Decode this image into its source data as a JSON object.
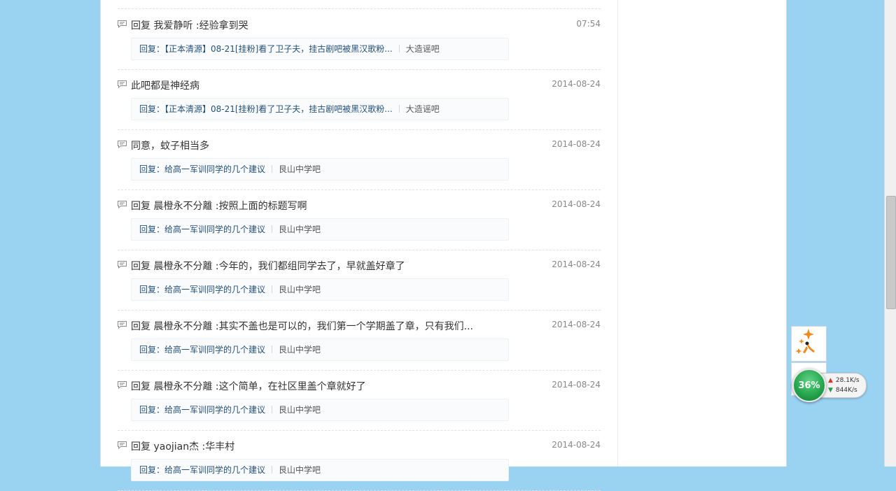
{
  "posts": [
    {
      "title": "回复 我爱静听 :经验拿到哭",
      "time": "07:54",
      "prefix": "回复：",
      "thread": "【正本清源】08-21[挂粉]看了卫子夫，挂古剧吧被黑汉歌粉...",
      "forum": "大造谣吧"
    },
    {
      "title": "此吧都是神经病",
      "time": "2014-08-24",
      "prefix": "回复：",
      "thread": "【正本清源】08-21[挂粉]看了卫子夫，挂古剧吧被黑汉歌粉...",
      "forum": "大造谣吧"
    },
    {
      "title": "同意，蚊子相当多",
      "time": "2014-08-24",
      "prefix": "回复：",
      "thread": "给高一军训同学的几个建议",
      "forum": "艮山中学吧"
    },
    {
      "title": "回复 晨橙永不分離 :按照上面的标题写啊",
      "time": "2014-08-24",
      "prefix": "回复：",
      "thread": "给高一军训同学的几个建议",
      "forum": "艮山中学吧"
    },
    {
      "title": "回复 晨橙永不分離 :今年的，我们都组同学去了，早就盖好章了",
      "time": "2014-08-24",
      "prefix": "回复：",
      "thread": "给高一军训同学的几个建议",
      "forum": "艮山中学吧"
    },
    {
      "title": "回复 晨橙永不分離 :其实不盖也是可以的，我们第一个学期盖了章，只有我们...",
      "time": "2014-08-24",
      "prefix": "回复：",
      "thread": "给高一军训同学的几个建议",
      "forum": "艮山中学吧"
    },
    {
      "title": "回复 晨橙永不分離 :这个简单，在社区里盖个章就好了",
      "time": "2014-08-24",
      "prefix": "回复：",
      "thread": "给高一军训同学的几个建议",
      "forum": "艮山中学吧"
    },
    {
      "title": "回复 yaojian杰 :华丰村",
      "time": "2014-08-24",
      "prefix": "回复：",
      "thread": "给高一军训同学的几个建议",
      "forum": "艮山中学吧"
    }
  ],
  "widget": {
    "percent": "36%",
    "upload": "28.1K/s",
    "download": "844K/s",
    "up_icon": "up-arrow-icon",
    "down_icon": "down-arrow-icon",
    "tool_icon": "sparkle-figure-icon"
  },
  "colors": {
    "background": "#9ad3f2",
    "link": "#24517a",
    "ball": "#23a24b"
  }
}
